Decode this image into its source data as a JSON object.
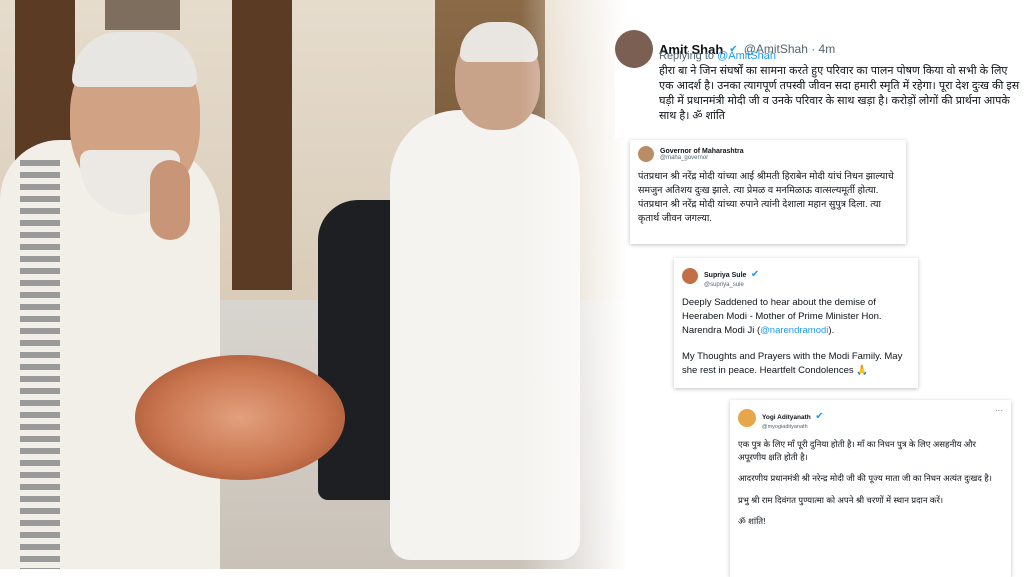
{
  "tweets": {
    "amit": {
      "name": "Amit Shah",
      "verified_icon": "verified-badge",
      "handle": "@AmitShah · 4m",
      "replying_prefix": "Replying to ",
      "replying_handle": "@AmitShah",
      "text": "हीरा बा ने जिन संघर्षों का सामना करते हुए परिवार का पालन पोषण किया वो सभी के लिए एक आदर्श है। उनका त्यागपूर्ण तपस्वी जीवन सदा हमारी स्मृति में रहेगा। पूरा देश दुःख की इस घड़ी में प्रधानमंत्री मोदी जी व उनके परिवार के साथ खड़ा है। करोड़ों लोगों की प्रार्थना आपके साथ है। ॐ शांति"
    },
    "governor": {
      "name": "Governor of Maharashtra",
      "handle": "@maha_governor",
      "text": "पंतप्रधान श्री नरेंद्र मोदी यांच्या आई श्रीमती हिराबेन मोदी यांचं निधन झाल्याचे समजुन अतिशय दुःख झाले. त्या प्रेमळ व मनमिळाऊ वात्सल्यमूर्ती होत्या. पंतप्रधान श्री नरेंद्र मोदी यांच्या रुपाने त्यांनी देशाला महान सुपुत्र दिला. त्या कृतार्थ जीवन जगल्या."
    },
    "supriya": {
      "name": "Supriya Sule",
      "handle": "@supriya_sule",
      "text1": "Deeply Saddened to hear about the demise of Heeraben Modi - Mother of Prime Minister Hon. Narendra Modi Ji (",
      "mention": "@narendramodi",
      "text1_end": ").",
      "text2": "My Thoughts and Prayers with the Modi Family. May she rest in peace. Heartfelt Condolences 🙏"
    },
    "yogi": {
      "name": "Yogi Adityanath",
      "handle": "@myogiadityanath",
      "more": "···",
      "p1": "एक पुत्र के लिए माँ पूरी दुनिया होती है। माँ का निधन पुत्र के लिए असहनीय और अपूरणीय क्षति होती है।",
      "p2": "आदरणीय प्रधानमंत्री श्री नरेन्द्र मोदी जी की पूज्य माता जी का निधन अत्यंत दुःखद है।",
      "p3": "प्रभु श्री राम दिवंगत पुण्यात्मा को अपने श्री चरणों में स्थान प्रदान करें।",
      "p4": "ॐ शांति!"
    }
  }
}
